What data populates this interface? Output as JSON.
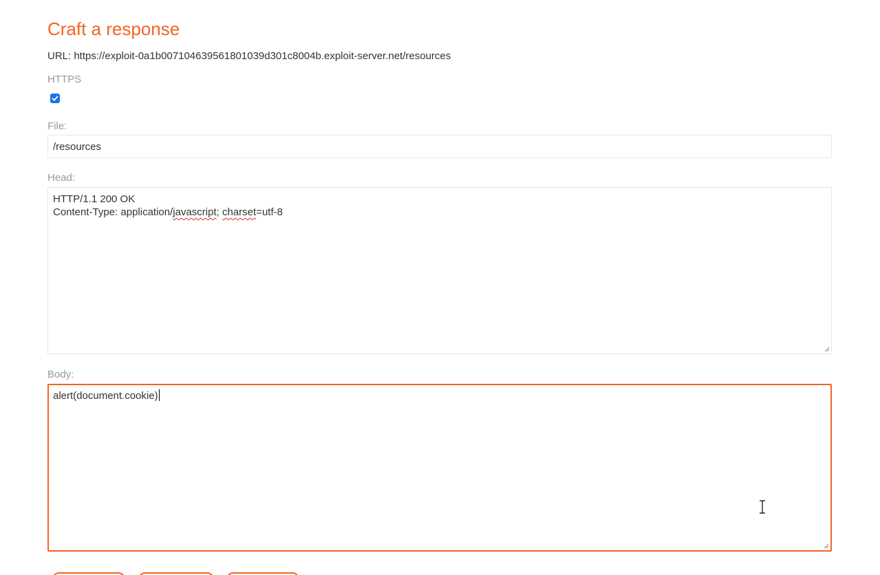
{
  "page": {
    "title": "Craft a response",
    "url_line": "URL: https://exploit-0a1b007104639561801039d301c8004b.exploit-server.net/resources"
  },
  "form": {
    "https": {
      "label": "HTTPS",
      "checked": true
    },
    "file": {
      "label": "File:",
      "value": "/resources"
    },
    "head": {
      "label": "Head:",
      "line1": "HTTP/1.1 200 OK",
      "line2_prefix": "Content-Type: application/",
      "line2_word1": "javascript",
      "line2_sep": "; ",
      "line2_word2": "charset",
      "line2_suffix": "=utf-8"
    },
    "body": {
      "label": "Body:",
      "value": "alert(document.cookie)"
    }
  },
  "buttons": [
    {
      "label": ""
    },
    {
      "label": ""
    },
    {
      "label": ""
    }
  ],
  "colors": {
    "accent": "#f26522",
    "label": "#999999",
    "text": "#333332",
    "checkbox": "#1a73e8"
  }
}
